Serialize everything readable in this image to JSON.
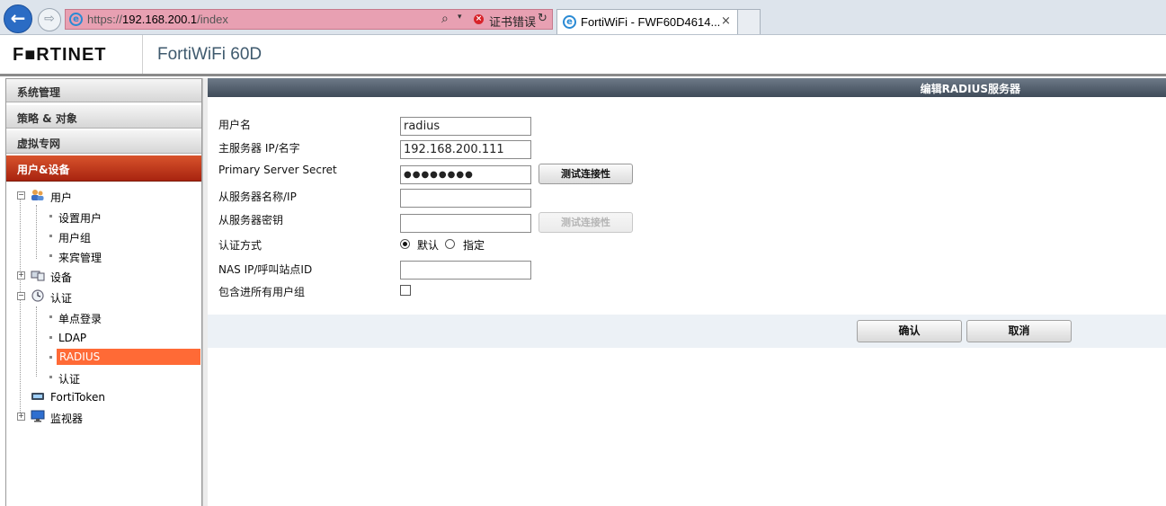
{
  "browser": {
    "url_prefix": "https://",
    "url_host": "192.168.200.1",
    "url_path": "/index",
    "cert_error": "证书错误",
    "tab_title": "FortiWiFi - FWF60D4614...",
    "tab_close": "×",
    "back_glyph": "←",
    "forward_glyph": "⇨",
    "search_glyph": "⌕",
    "dropdown_glyph": "▾",
    "refresh_glyph": "↻",
    "error_glyph": "×",
    "ie_glyph": "e"
  },
  "header": {
    "logo": "F■RTINET",
    "product": "FortiWiFi 60D"
  },
  "sidebar": {
    "sections": [
      {
        "label": "系统管理",
        "active": false
      },
      {
        "label": "策略 & 对象",
        "active": false
      },
      {
        "label": "虚拟专网",
        "active": false
      },
      {
        "label": "用户&设备",
        "active": true
      }
    ],
    "tree": {
      "user": {
        "label": "用户",
        "icon": "users-icon",
        "expander": "−"
      },
      "user_setup": "设置用户",
      "user_group": "用户组",
      "guest_mgmt": "来宾管理",
      "device": {
        "label": "设备",
        "icon": "device-icon",
        "expander": "+"
      },
      "auth": {
        "label": "认证",
        "icon": "clock-icon",
        "expander": "−"
      },
      "sso": "单点登录",
      "ldap": "LDAP",
      "radius": "RADIUS",
      "auth_sub": "认证",
      "fortitoken": {
        "label": "FortiToken",
        "icon": "token-icon"
      },
      "monitor": {
        "label": "监视器",
        "icon": "monitor-icon",
        "expander": "+"
      }
    }
  },
  "panel": {
    "title": "编辑RADIUS服务器",
    "fields": {
      "name_label": "用户名",
      "name_value": "radius",
      "primary_ip_label": "主服务器 IP/名字",
      "primary_ip_value": "192.168.200.111",
      "primary_secret_label": "Primary Server Secret",
      "primary_secret_value": "●●●●●●●●",
      "secondary_ip_label": "从服务器名称/IP",
      "secondary_ip_value": "",
      "secondary_secret_label": "从服务器密钥",
      "secondary_secret_value": "",
      "auth_method_label": "认证方式",
      "auth_default": "默认",
      "auth_specify": "指定",
      "auth_selected": "默认",
      "nas_label": "NAS IP/呼叫站点ID",
      "nas_value": "",
      "include_groups_label": "包含进所有用户组",
      "include_groups_checked": false
    },
    "test_connectivity": "测试连接性",
    "test_connectivity_disabled": "测试连接性",
    "ok": "确认",
    "cancel": "取消"
  },
  "colors": {
    "active_section": "#c0391d",
    "selected_item": "#ff6a36",
    "title_bar": "#4f5b69",
    "address_bar_error": "#e8a0b2"
  }
}
